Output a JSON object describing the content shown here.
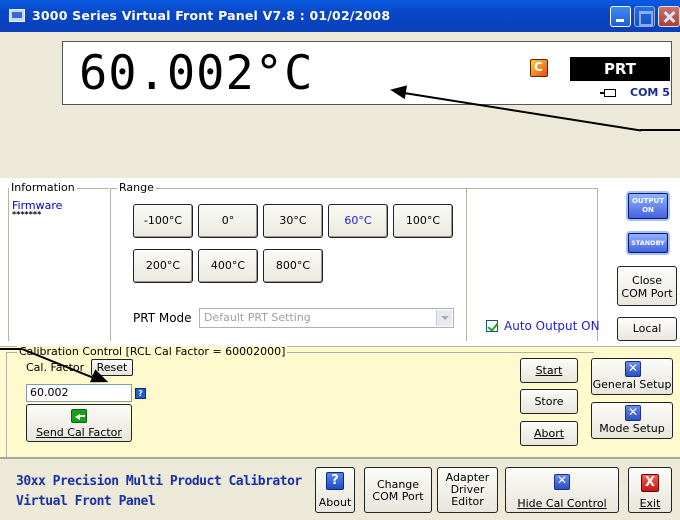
{
  "window": {
    "title": "3000 Series Virtual Front Panel V7.8 : 01/02/2008"
  },
  "display": {
    "reading": "60.002°C",
    "sensor": "PRT",
    "com_port": "COM 5"
  },
  "info": {
    "legend": "Information",
    "firmware_label": "Firmware",
    "firmware_value": "*******"
  },
  "range": {
    "legend": "Range",
    "buttons": [
      "-100°C",
      "0°",
      "30°C",
      "60°C",
      "100°C",
      "200°C",
      "400°C",
      "800°C"
    ],
    "selected": "60°C",
    "prt_mode_label": "PRT Mode",
    "prt_mode_value": "Default PRT Setting",
    "auto_output_label": "Auto Output ON",
    "auto_output_checked": true
  },
  "side": {
    "output_on_line1": "OUTPUT",
    "output_on_line2": "ON",
    "standby": "STANDBY",
    "close_com_line1": "Close",
    "close_com_line2": "COM Port",
    "local": "Local"
  },
  "calibration": {
    "legend": "Calibration Control [RCL Cal Factor = 60002000]",
    "cal_factor_label": "Cal. Factor",
    "reset": "Reset",
    "cal_factor_value": "60.002",
    "send": "Send Cal Factor",
    "start": "Start",
    "store": "Store",
    "abort": "Abort",
    "general_setup": "General Setup",
    "mode_setup": "Mode Setup"
  },
  "bottom": {
    "title_line1": "30xx Precision Multi Product Calibrator",
    "title_line2": "Virtual Front Panel",
    "about": "About",
    "change_com_line1": "Change",
    "change_com_line2": "COM Port",
    "adapter_line1": "Adapter",
    "adapter_line2": "Driver",
    "adapter_line3": "Editor",
    "hide_cal": "Hide Cal Control",
    "exit": "Exit"
  },
  "colors": {
    "titlebar": "#0a4fd6",
    "accent_blue": "#1c1cd8",
    "cal_panel": "#fffacd",
    "window_bg": "#ece9d8"
  }
}
